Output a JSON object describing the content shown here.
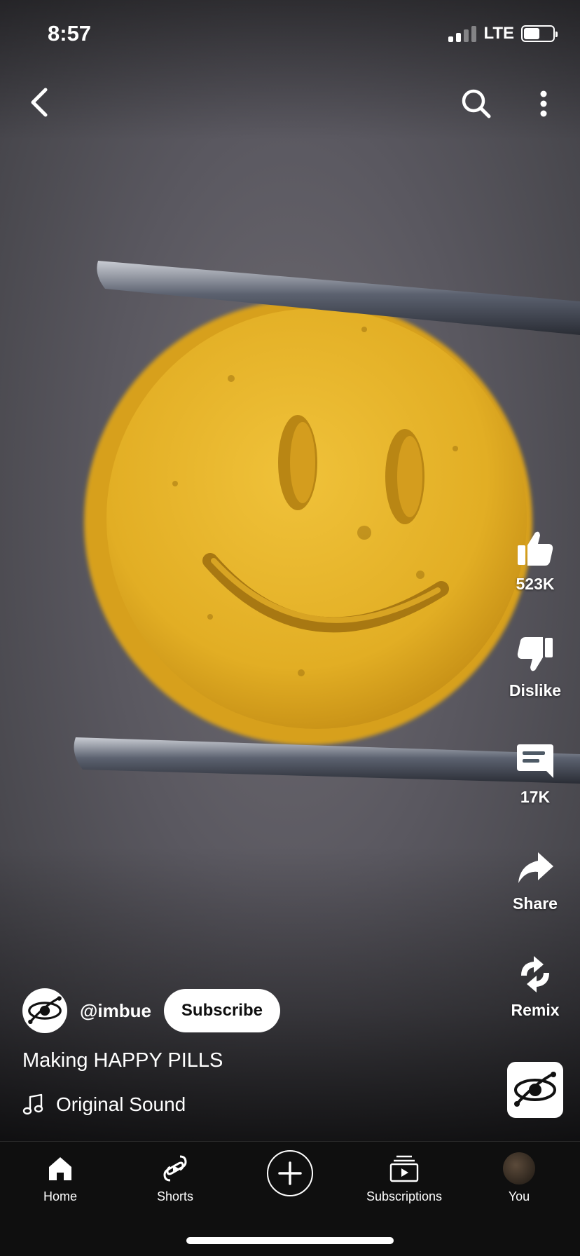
{
  "status_bar": {
    "time": "8:57",
    "network": "LTE",
    "signal_bars_active": 2,
    "battery_level": 0.55
  },
  "top_nav": {
    "icons": [
      "back-arrow-icon",
      "search-icon",
      "more-vertical-icon"
    ]
  },
  "actions": {
    "like_count": "523K",
    "dislike_label": "Dislike",
    "comments_count": "17K",
    "share_label": "Share",
    "remix_label": "Remix"
  },
  "channel": {
    "handle": "@imbue",
    "subscribe_label": "Subscribe"
  },
  "video": {
    "title": "Making HAPPY PILLS",
    "sound_label": "Original Sound"
  },
  "bottom_nav": {
    "items": [
      {
        "label": "Home",
        "icon": "home-icon"
      },
      {
        "label": "Shorts",
        "icon": "shorts-icon"
      },
      {
        "label": "",
        "icon": "create-plus-icon"
      },
      {
        "label": "Subscriptions",
        "icon": "subscriptions-icon"
      },
      {
        "label": "You",
        "icon": "profile-avatar"
      }
    ]
  },
  "colors": {
    "pill_yellow": "#e6b62a",
    "nav_background": "#0f0f0f",
    "subscribe_text": "#0f0f0f"
  }
}
